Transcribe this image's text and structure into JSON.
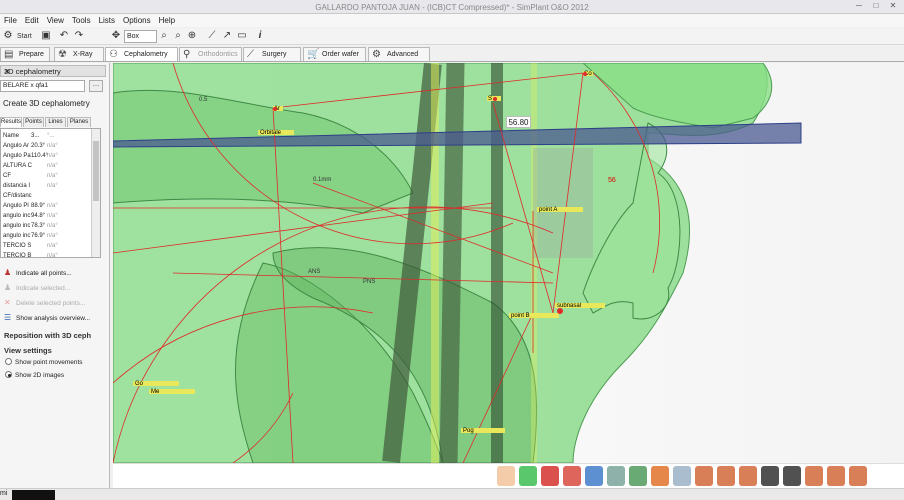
{
  "window": {
    "title": "GALLARDO PANTOJA JUAN - (ICB)CT Compressed)* - SimPlant O&O 2012",
    "controls": [
      "─",
      "□",
      "✕"
    ]
  },
  "menu": [
    "File",
    "Edit",
    "View",
    "Tools",
    "Lists",
    "Options",
    "Help"
  ],
  "toolbar": {
    "start_label": "Start",
    "box_label": "Box",
    "icons": [
      "open-folder-icon",
      "save-icon",
      "undo-icon",
      "redo-icon",
      "move-icon",
      "zoom-in-icon",
      "zoom-out-icon",
      "zoom-fit-icon",
      "measure-icon",
      "line-icon",
      "comment-icon",
      "info-icon"
    ]
  },
  "tabs": [
    {
      "label": "Prepare",
      "icon": "prepare-icon",
      "state": "normal"
    },
    {
      "label": "X-Ray",
      "icon": "xray-icon",
      "state": "normal"
    },
    {
      "label": "Cephalometry",
      "icon": "ceph-icon",
      "state": "active"
    },
    {
      "label": "Orthodontics",
      "icon": "ortho-icon",
      "state": "dim"
    },
    {
      "label": "Surgery",
      "icon": "surgery-icon",
      "state": "normal"
    },
    {
      "label": "Order wafer",
      "icon": "cart-icon",
      "state": "normal"
    },
    {
      "label": "Advanced",
      "icon": "gear-icon",
      "state": "normal"
    }
  ],
  "panel": {
    "title": "3D cephalometry",
    "analysis": "BELARE x qfa1",
    "create_label": "Create 3D cephalometry",
    "subtabs": [
      "Results",
      "Points",
      "Lines",
      "Planes"
    ],
    "table_header": [
      "Name",
      "3...",
      "°..."
    ],
    "rows": [
      {
        "name": "Angulo Ar",
        "v": "20.3°",
        "u": "n/a°"
      },
      {
        "name": "Angulo Pa",
        "v": "110.4°",
        "u": "n/a°"
      },
      {
        "name": "ALTURA C",
        "v": "",
        "u": "n/a°"
      },
      {
        "name": "CF",
        "v": "",
        "u": "n/a°"
      },
      {
        "name": "distancia I",
        "v": "",
        "u": "n/a°"
      },
      {
        "name": "CF/distanc",
        "v": "",
        "u": ""
      },
      {
        "name": "Angulo Pl",
        "v": "88.9°",
        "u": "n/a°"
      },
      {
        "name": "angulo inc",
        "v": "94.8°",
        "u": "n/a°"
      },
      {
        "name": "angulo inc",
        "v": "78.3°",
        "u": "n/a°"
      },
      {
        "name": "angulo inc",
        "v": "76.9°",
        "u": "n/a°"
      },
      {
        "name": "TERCIO S",
        "v": "",
        "u": "n/a°"
      },
      {
        "name": "TERCIO B",
        "v": "",
        "u": "n/a°"
      }
    ],
    "actions": [
      {
        "label": "Indicate all points...",
        "disabled": false
      },
      {
        "label": "Indicate selected...",
        "disabled": true
      },
      {
        "label": "Delete selected points...",
        "disabled": true
      },
      {
        "label": "Show analysis overview...",
        "disabled": false
      }
    ],
    "reposition_label": "Reposition with 3D ceph",
    "view_settings_label": "View settings",
    "radios": [
      {
        "label": "Show point movements",
        "checked": false
      },
      {
        "label": "Show 2D images",
        "checked": true
      }
    ]
  },
  "viewport": {
    "measurement_value": "56.80",
    "measurement_marker": "56",
    "labels": [
      "0.1mm",
      "0.5",
      "Ar",
      "Orbitale",
      "S",
      "Co",
      "point A",
      "subnasal",
      "point B",
      "ANS",
      "PNS",
      "Go",
      "Me",
      "Pog"
    ]
  },
  "bottom_icons": [
    "face-icon",
    "skull-green-icon",
    "skull-red-icon",
    "tooth-red-icon",
    "tooth-blue-icon",
    "jaw-icon",
    "teeth-icon",
    "mandible-icon",
    "maxilla-icon",
    "arch-icon",
    "arch-icon",
    "arch-icon",
    "nerve-icon",
    "nerve-icon",
    "arch-icon",
    "arch-icon",
    "arch-icon"
  ],
  "colors": {
    "bone_green": "#6ecf72",
    "ceph_red": "#e02a2a",
    "plane_blue": "#3a4fa8"
  }
}
